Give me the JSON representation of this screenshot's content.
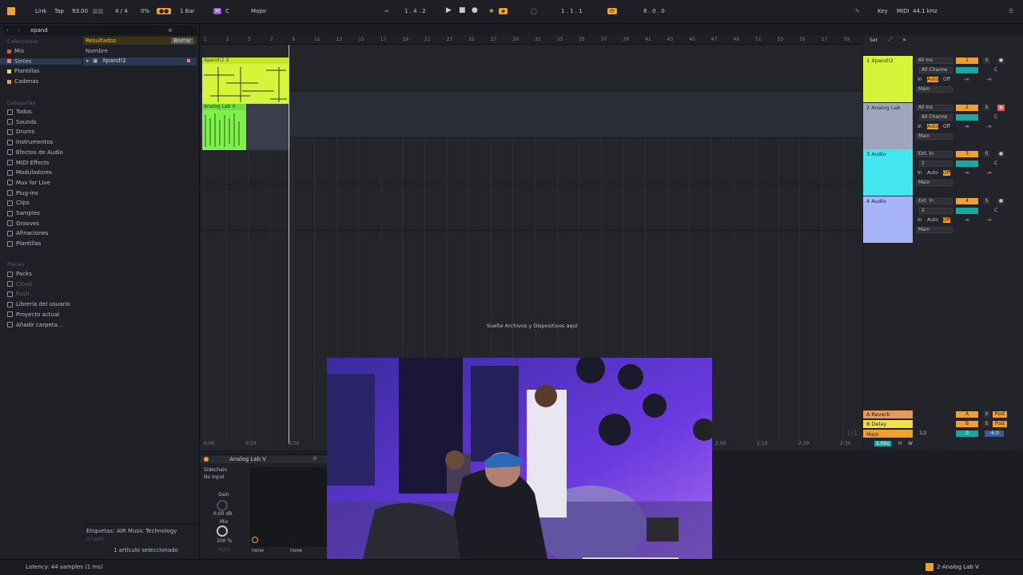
{
  "topbar": {
    "link": "Link",
    "tap": "Tap",
    "tempo": "93.00",
    "signature": "4 / 4",
    "swing": "0%",
    "quantize": "1 Bar",
    "key": "C",
    "scale": "Major",
    "position": "1 . 4 . 2",
    "loop_start": "1 . 1 . 1",
    "loop_len": "8 . 0 . 0",
    "key_label": "Key",
    "midi_label": "MIDI",
    "sample_rate": "44.1 kHz"
  },
  "browser": {
    "search_value": "xpand",
    "collections_head": "Colecciones",
    "collections": [
      {
        "label": "Mix",
        "color": "#e05a3a"
      },
      {
        "label": "Sintes",
        "color": "#f07a8a"
      },
      {
        "label": "Plantillas",
        "color": "#e8e04a"
      },
      {
        "label": "Cadenas",
        "color": "#f0a030"
      }
    ],
    "categories_head": "Categorías",
    "categories": [
      "Todos",
      "Sounds",
      "Drums",
      "Instrumentos",
      "Efectos de Audio",
      "MIDI Effects",
      "Moduladores",
      "Max for Live",
      "Plug-ins",
      "Clips",
      "Samples",
      "Grooves",
      "Afinaciones",
      "Plantillas"
    ],
    "places_head": "Places",
    "places": [
      "Packs",
      "Cloud",
      "Push",
      "Librería del usuario",
      "Proyecto actual",
      "Añadir carpeta..."
    ],
    "results_label": "Resultados",
    "clear_label": "Borrar",
    "name_col": "Nombre",
    "result_item": "Xpand!2",
    "tags_label": "Etiquetas:",
    "tag_value": "AIR Music Technology",
    "add_label": "Añadir",
    "selected_count": "1 artículo seleccionado"
  },
  "arrangement": {
    "ruler": [
      "1",
      "3",
      "5",
      "7",
      "9",
      "11",
      "13",
      "15",
      "17",
      "19",
      "21",
      "23",
      "25",
      "27",
      "29",
      "31",
      "33",
      "35",
      "37",
      "39",
      "41",
      "43",
      "45",
      "47",
      "49",
      "51",
      "53",
      "55",
      "57",
      "59"
    ],
    "clips": [
      {
        "label": "Xpand!2 3",
        "color": "#d4f53a"
      },
      {
        "label": "Analog Lab V",
        "color": "#7ef04a"
      }
    ],
    "drop_hint": "Suelte Archivos y Dispositivos aquí",
    "time_labels": [
      "0:00",
      "0:10",
      "0:20"
    ],
    "time_labels_right": [
      "2:00",
      "2:10",
      "2:20",
      "2:30"
    ],
    "zoom_label": "1/1"
  },
  "mixer": {
    "set_label": "Set",
    "tracks": [
      {
        "name": "1 Xpand!2",
        "color": "#d4f53a",
        "input": "All Ins",
        "channel": "All Channe",
        "out": "Main",
        "num": "1"
      },
      {
        "name": "2 Analog Lab",
        "color": "#9ea6bd",
        "input": "All Ins",
        "channel": "All Channe",
        "out": "Main",
        "num": "2"
      },
      {
        "name": "3 Audio",
        "color": "#44e6f0",
        "input": "Ext. In",
        "channel": "1",
        "out": "Main",
        "num": "3"
      },
      {
        "name": "4 Audio",
        "color": "#a8b4f8",
        "input": "Ext. In",
        "channel": "2",
        "out": "Main",
        "num": "4"
      }
    ],
    "monitor": [
      "In",
      "Auto",
      "Off"
    ],
    "volume_inf": "-∞",
    "pan": "C",
    "returns": [
      {
        "name": "A Reverb",
        "letter": "A",
        "post": "Post",
        "color": "#e89a5a"
      },
      {
        "name": "B Delay",
        "letter": "B",
        "post": "Post",
        "color": "#f5e04a"
      }
    ],
    "master": {
      "name": "Main",
      "cue": "1/2",
      "vol": "0",
      "db": "-6.0",
      "color": "#f0a030"
    },
    "solo": "S",
    "ratio": "1.00x",
    "h": "H",
    "w": "W"
  },
  "device": {
    "title": "Analog Lab V",
    "sidechain": "Sidechain",
    "no_input": "No Input",
    "none_a": "none",
    "gain_label": "Gain",
    "gain_value": "0.00 dB",
    "mix_label": "Mix",
    "mix_value": "100 %",
    "mute_label": "Mute",
    "sel_a": "none",
    "sel_b": "none"
  },
  "status": {
    "latency": "Latency: 44 samples (1 ms)",
    "track": "2-Analog Lab V"
  }
}
